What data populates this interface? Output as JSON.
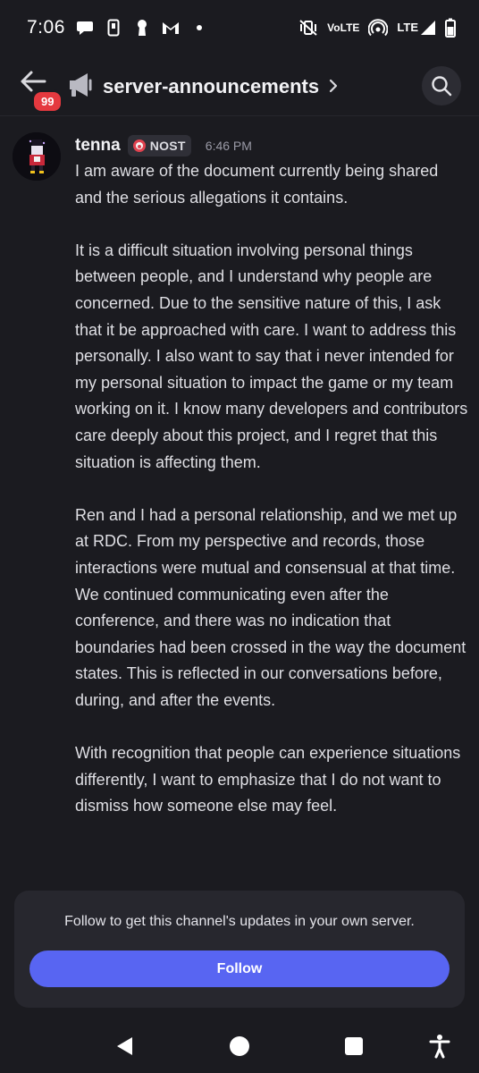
{
  "status_bar": {
    "time": "7:06",
    "lte_label": "LTE",
    "volte_top": "Vo",
    "volte_bottom": "LTE"
  },
  "header": {
    "unread_badge": "99",
    "channel_name": "server-announcements"
  },
  "message": {
    "author": "tenna",
    "tag": "NOST",
    "timestamp": "6:46 PM",
    "paragraphs": [
      "I am aware of the document currently being shared and the serious allegations it contains.",
      "It is a difficult situation involving personal things between people, and I understand why people are concerned. Due to the sensitive nature of this, I ask that it be approached with care. I want to address this personally. I also want to say that i never intended for my personal situation to impact the game or my team working on it. I know many developers and contributors care deeply about this project, and I regret that this situation is affecting them.",
      "Ren and I had a personal relationship, and we met up at RDC. From my perspective and records, those interactions were mutual and consensual at that time. We continued communicating even after the conference, and there was no indication that boundaries had been crossed in the way the document states. This is reflected in our conversations before, during, and after the events.",
      "With recognition that people can experience situations differently, I want to emphasize that I do not want to dismiss how someone else may feel."
    ]
  },
  "follow_card": {
    "text": "Follow to get this channel's updates in your own server.",
    "button_label": "Follow"
  },
  "colors": {
    "background": "#1b1b20",
    "accent": "#5865f2",
    "badge": "#e5393f"
  },
  "icons": [
    "back-arrow-icon",
    "megaphone-icon",
    "chevron-right-icon",
    "search-icon",
    "back-triangle-icon",
    "home-circle-icon",
    "recents-square-icon",
    "accessibility-icon"
  ]
}
